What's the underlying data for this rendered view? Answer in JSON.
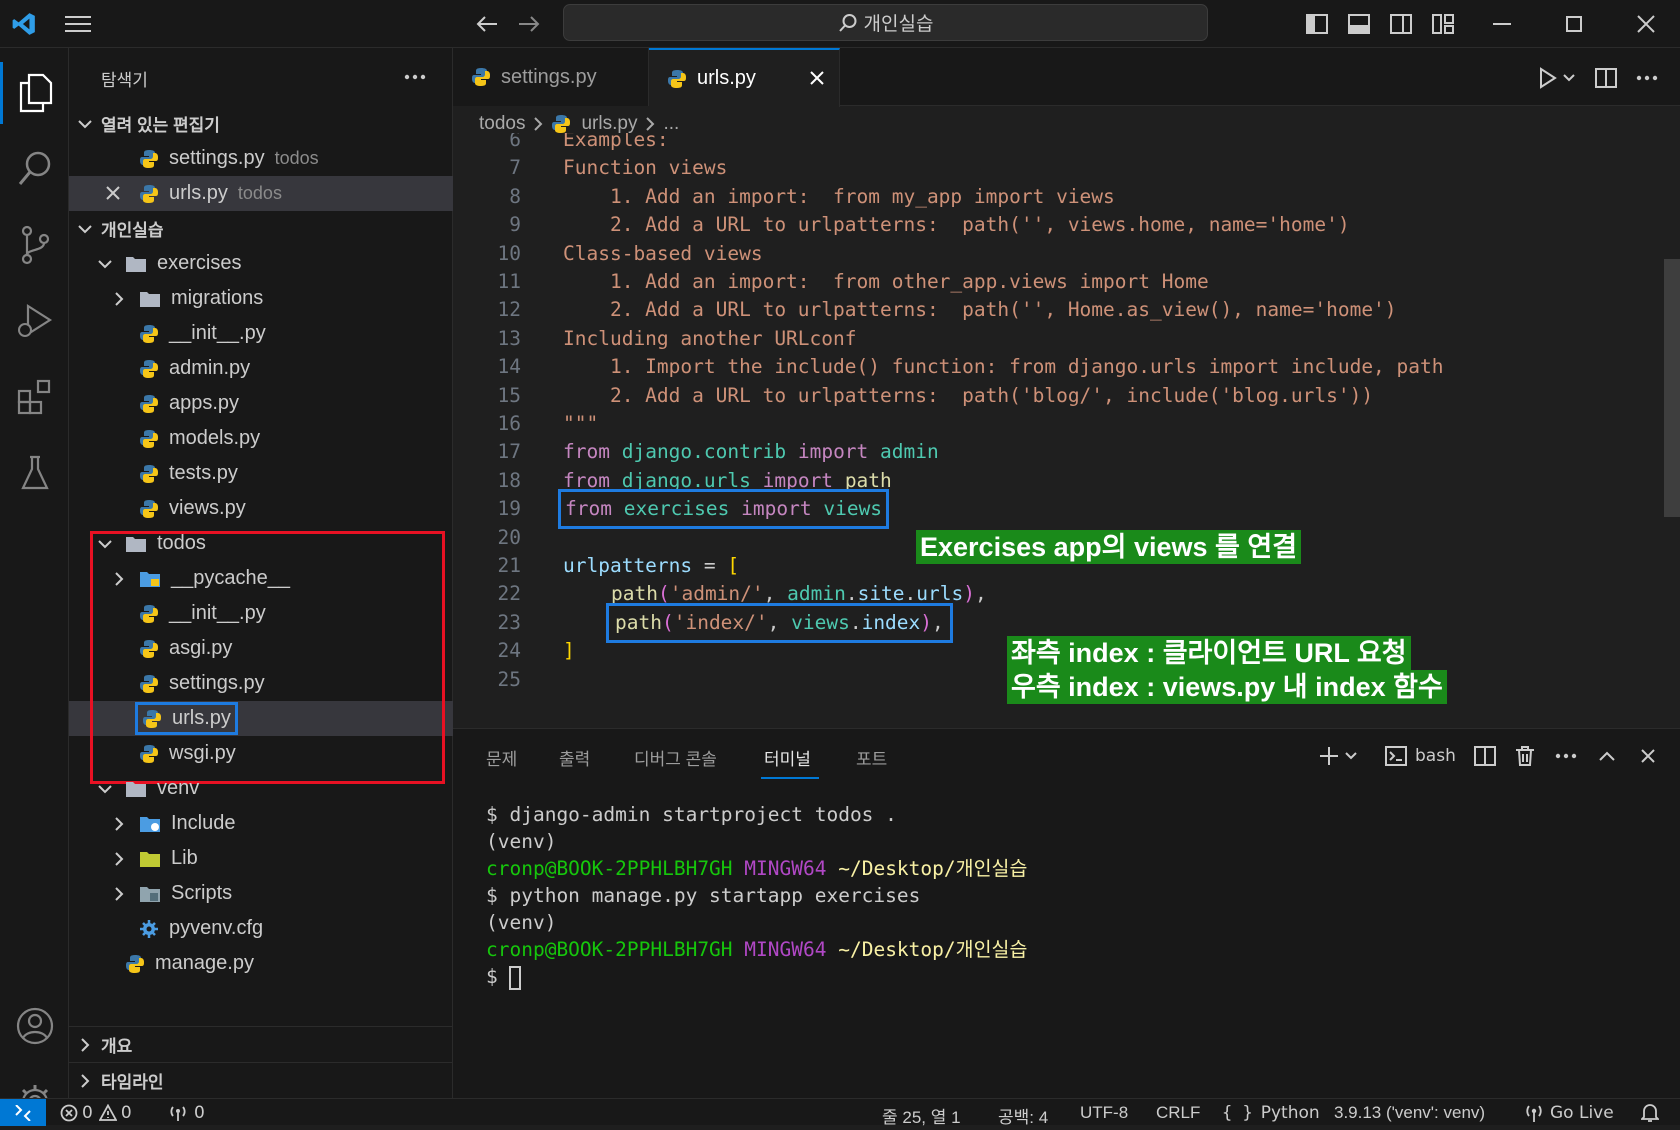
{
  "titlebar": {
    "search": "개인실습"
  },
  "sidebar": {
    "title": "탐색기",
    "open_editors": {
      "label": "열려 있는 편집기",
      "items": [
        {
          "name": "settings.py",
          "folder": "todos"
        },
        {
          "name": "urls.py",
          "folder": "todos"
        }
      ]
    },
    "workspace": "개인실습",
    "tree": {
      "exercises": "exercises",
      "migrations": "migrations",
      "ex_init": "__init__.py",
      "admin": "admin.py",
      "apps": "apps.py",
      "models": "models.py",
      "tests": "tests.py",
      "views": "views.py",
      "todos": "todos",
      "pycache": "__pycache__",
      "td_init": "__init__.py",
      "asgi": "asgi.py",
      "settings": "settings.py",
      "urls": "urls.py",
      "wsgi": "wsgi.py",
      "venv": "venv",
      "include": "Include",
      "lib": "Lib",
      "scripts": "Scripts",
      "pyvenv": "pyvenv.cfg",
      "manage": "manage.py"
    },
    "outline": "개요",
    "timeline": "타임라인"
  },
  "tabs": [
    {
      "label": "settings.py",
      "active": false
    },
    {
      "label": "urls.py",
      "active": true
    }
  ],
  "breadcrumb": {
    "folder": "todos",
    "file": "urls.py",
    "more": "..."
  },
  "code": {
    "line_numbers": [
      "6",
      "7",
      "8",
      "9",
      "10",
      "11",
      "12",
      "13",
      "14",
      "15",
      "16",
      "17",
      "18",
      "19",
      "20",
      "21",
      "22",
      "23",
      "24",
      "25"
    ],
    "l6": "Examples:",
    "l7": "Function views",
    "l8": "    1. Add an import:  from my_app import views",
    "l9": "    2. Add a URL to urlpatterns:  path('', views.home, name='home')",
    "l10": "Class-based views",
    "l11": "    1. Add an import:  from other_app.views import Home",
    "l12": "    2. Add a URL to urlpatterns:  path('', Home.as_view(), name='home')",
    "l13": "Including another URLconf",
    "l14": "    1. Import the include() function: from django.urls import include, path",
    "l15": "    2. Add a URL to urlpatterns:  path('blog/', include('blog.urls'))",
    "l16": "\"\"\"",
    "l17": {
      "k1": "from",
      "m": "django.contrib",
      "k2": "import",
      "n": "admin"
    },
    "l18": {
      "k1": "from",
      "m": "django.urls",
      "k2": "import",
      "n": "path"
    },
    "l19": {
      "k1": "from",
      "m": "exercises",
      "k2": "import",
      "n": "views"
    },
    "l21": {
      "v": "urlpatterns",
      "eq": " = ",
      "b": "["
    },
    "l22": {
      "f": "path",
      "s": "'admin/'",
      "a": "admin",
      "b": "site",
      "c": "urls"
    },
    "l23": {
      "f": "path",
      "s": "'index/'",
      "a": "views",
      "b": "index"
    },
    "l24": "]"
  },
  "annotations": {
    "a1": "Exercises app의 views 를 연결",
    "a2": "좌측 index : 클라이언트 URL 요청",
    "a3": "우측 index : views.py 내 index 함수"
  },
  "panel": {
    "tabs": [
      "문제",
      "출력",
      "디버그 콘솔",
      "터미널",
      "포트"
    ],
    "shell": "bash",
    "terminal": {
      "l1": "$ django-admin startproject todos .",
      "l2": "(venv)",
      "user": "cronp@BOOK-2PPHLBH7GH",
      "env": "MINGW64",
      "path": "~/Desktop/개인실습",
      "l4": "$ python manage.py startapp exercises",
      "l5": "(venv)",
      "prompt": "$ "
    }
  },
  "status": {
    "errors": "0",
    "warnings": "0",
    "ports": "0",
    "position": "줄 25, 열 1",
    "spaces": "공백: 4",
    "encoding": "UTF-8",
    "eol": "CRLF",
    "language": "Python",
    "interpreter": "3.9.13 ('venv': venv)",
    "golive": "Go Live"
  },
  "colors": {
    "accent": "#0078d4",
    "annotation_bg": "#1a8a1a",
    "highlight_red": "#e81123",
    "highlight_blue": "#1e7be0"
  }
}
